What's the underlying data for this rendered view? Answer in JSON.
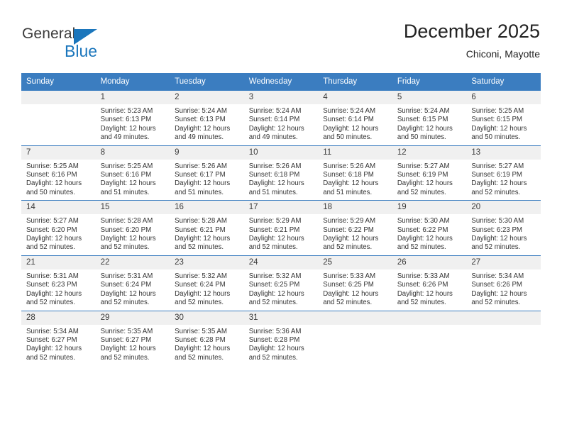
{
  "brand": {
    "name_part1": "General",
    "name_part2": "Blue",
    "color_blue": "#1b76bc",
    "triangle_icon": "triangle-right-icon"
  },
  "header": {
    "title": "December 2025",
    "location": "Chiconi, Mayotte"
  },
  "calendar": {
    "weekday_headers": [
      "Sunday",
      "Monday",
      "Tuesday",
      "Wednesday",
      "Thursday",
      "Friday",
      "Saturday"
    ],
    "header_bg": "#3b7dc0",
    "daynum_bg": "#f0f0f0",
    "weeks": [
      [
        {
          "day": "",
          "empty": true,
          "sunrise": "",
          "sunset": "",
          "daylight1": "",
          "daylight2": ""
        },
        {
          "day": "1",
          "sunrise": "Sunrise: 5:23 AM",
          "sunset": "Sunset: 6:13 PM",
          "daylight1": "Daylight: 12 hours",
          "daylight2": "and 49 minutes."
        },
        {
          "day": "2",
          "sunrise": "Sunrise: 5:24 AM",
          "sunset": "Sunset: 6:13 PM",
          "daylight1": "Daylight: 12 hours",
          "daylight2": "and 49 minutes."
        },
        {
          "day": "3",
          "sunrise": "Sunrise: 5:24 AM",
          "sunset": "Sunset: 6:14 PM",
          "daylight1": "Daylight: 12 hours",
          "daylight2": "and 49 minutes."
        },
        {
          "day": "4",
          "sunrise": "Sunrise: 5:24 AM",
          "sunset": "Sunset: 6:14 PM",
          "daylight1": "Daylight: 12 hours",
          "daylight2": "and 50 minutes."
        },
        {
          "day": "5",
          "sunrise": "Sunrise: 5:24 AM",
          "sunset": "Sunset: 6:15 PM",
          "daylight1": "Daylight: 12 hours",
          "daylight2": "and 50 minutes."
        },
        {
          "day": "6",
          "sunrise": "Sunrise: 5:25 AM",
          "sunset": "Sunset: 6:15 PM",
          "daylight1": "Daylight: 12 hours",
          "daylight2": "and 50 minutes."
        }
      ],
      [
        {
          "day": "7",
          "sunrise": "Sunrise: 5:25 AM",
          "sunset": "Sunset: 6:16 PM",
          "daylight1": "Daylight: 12 hours",
          "daylight2": "and 50 minutes."
        },
        {
          "day": "8",
          "sunrise": "Sunrise: 5:25 AM",
          "sunset": "Sunset: 6:16 PM",
          "daylight1": "Daylight: 12 hours",
          "daylight2": "and 51 minutes."
        },
        {
          "day": "9",
          "sunrise": "Sunrise: 5:26 AM",
          "sunset": "Sunset: 6:17 PM",
          "daylight1": "Daylight: 12 hours",
          "daylight2": "and 51 minutes."
        },
        {
          "day": "10",
          "sunrise": "Sunrise: 5:26 AM",
          "sunset": "Sunset: 6:18 PM",
          "daylight1": "Daylight: 12 hours",
          "daylight2": "and 51 minutes."
        },
        {
          "day": "11",
          "sunrise": "Sunrise: 5:26 AM",
          "sunset": "Sunset: 6:18 PM",
          "daylight1": "Daylight: 12 hours",
          "daylight2": "and 51 minutes."
        },
        {
          "day": "12",
          "sunrise": "Sunrise: 5:27 AM",
          "sunset": "Sunset: 6:19 PM",
          "daylight1": "Daylight: 12 hours",
          "daylight2": "and 52 minutes."
        },
        {
          "day": "13",
          "sunrise": "Sunrise: 5:27 AM",
          "sunset": "Sunset: 6:19 PM",
          "daylight1": "Daylight: 12 hours",
          "daylight2": "and 52 minutes."
        }
      ],
      [
        {
          "day": "14",
          "sunrise": "Sunrise: 5:27 AM",
          "sunset": "Sunset: 6:20 PM",
          "daylight1": "Daylight: 12 hours",
          "daylight2": "and 52 minutes."
        },
        {
          "day": "15",
          "sunrise": "Sunrise: 5:28 AM",
          "sunset": "Sunset: 6:20 PM",
          "daylight1": "Daylight: 12 hours",
          "daylight2": "and 52 minutes."
        },
        {
          "day": "16",
          "sunrise": "Sunrise: 5:28 AM",
          "sunset": "Sunset: 6:21 PM",
          "daylight1": "Daylight: 12 hours",
          "daylight2": "and 52 minutes."
        },
        {
          "day": "17",
          "sunrise": "Sunrise: 5:29 AM",
          "sunset": "Sunset: 6:21 PM",
          "daylight1": "Daylight: 12 hours",
          "daylight2": "and 52 minutes."
        },
        {
          "day": "18",
          "sunrise": "Sunrise: 5:29 AM",
          "sunset": "Sunset: 6:22 PM",
          "daylight1": "Daylight: 12 hours",
          "daylight2": "and 52 minutes."
        },
        {
          "day": "19",
          "sunrise": "Sunrise: 5:30 AM",
          "sunset": "Sunset: 6:22 PM",
          "daylight1": "Daylight: 12 hours",
          "daylight2": "and 52 minutes."
        },
        {
          "day": "20",
          "sunrise": "Sunrise: 5:30 AM",
          "sunset": "Sunset: 6:23 PM",
          "daylight1": "Daylight: 12 hours",
          "daylight2": "and 52 minutes."
        }
      ],
      [
        {
          "day": "21",
          "sunrise": "Sunrise: 5:31 AM",
          "sunset": "Sunset: 6:23 PM",
          "daylight1": "Daylight: 12 hours",
          "daylight2": "and 52 minutes."
        },
        {
          "day": "22",
          "sunrise": "Sunrise: 5:31 AM",
          "sunset": "Sunset: 6:24 PM",
          "daylight1": "Daylight: 12 hours",
          "daylight2": "and 52 minutes."
        },
        {
          "day": "23",
          "sunrise": "Sunrise: 5:32 AM",
          "sunset": "Sunset: 6:24 PM",
          "daylight1": "Daylight: 12 hours",
          "daylight2": "and 52 minutes."
        },
        {
          "day": "24",
          "sunrise": "Sunrise: 5:32 AM",
          "sunset": "Sunset: 6:25 PM",
          "daylight1": "Daylight: 12 hours",
          "daylight2": "and 52 minutes."
        },
        {
          "day": "25",
          "sunrise": "Sunrise: 5:33 AM",
          "sunset": "Sunset: 6:25 PM",
          "daylight1": "Daylight: 12 hours",
          "daylight2": "and 52 minutes."
        },
        {
          "day": "26",
          "sunrise": "Sunrise: 5:33 AM",
          "sunset": "Sunset: 6:26 PM",
          "daylight1": "Daylight: 12 hours",
          "daylight2": "and 52 minutes."
        },
        {
          "day": "27",
          "sunrise": "Sunrise: 5:34 AM",
          "sunset": "Sunset: 6:26 PM",
          "daylight1": "Daylight: 12 hours",
          "daylight2": "and 52 minutes."
        }
      ],
      [
        {
          "day": "28",
          "sunrise": "Sunrise: 5:34 AM",
          "sunset": "Sunset: 6:27 PM",
          "daylight1": "Daylight: 12 hours",
          "daylight2": "and 52 minutes."
        },
        {
          "day": "29",
          "sunrise": "Sunrise: 5:35 AM",
          "sunset": "Sunset: 6:27 PM",
          "daylight1": "Daylight: 12 hours",
          "daylight2": "and 52 minutes."
        },
        {
          "day": "30",
          "sunrise": "Sunrise: 5:35 AM",
          "sunset": "Sunset: 6:28 PM",
          "daylight1": "Daylight: 12 hours",
          "daylight2": "and 52 minutes."
        },
        {
          "day": "31",
          "sunrise": "Sunrise: 5:36 AM",
          "sunset": "Sunset: 6:28 PM",
          "daylight1": "Daylight: 12 hours",
          "daylight2": "and 52 minutes."
        },
        {
          "day": "",
          "empty": true,
          "sunrise": "",
          "sunset": "",
          "daylight1": "",
          "daylight2": ""
        },
        {
          "day": "",
          "empty": true,
          "sunrise": "",
          "sunset": "",
          "daylight1": "",
          "daylight2": ""
        },
        {
          "day": "",
          "empty": true,
          "sunrise": "",
          "sunset": "",
          "daylight1": "",
          "daylight2": ""
        }
      ]
    ]
  }
}
